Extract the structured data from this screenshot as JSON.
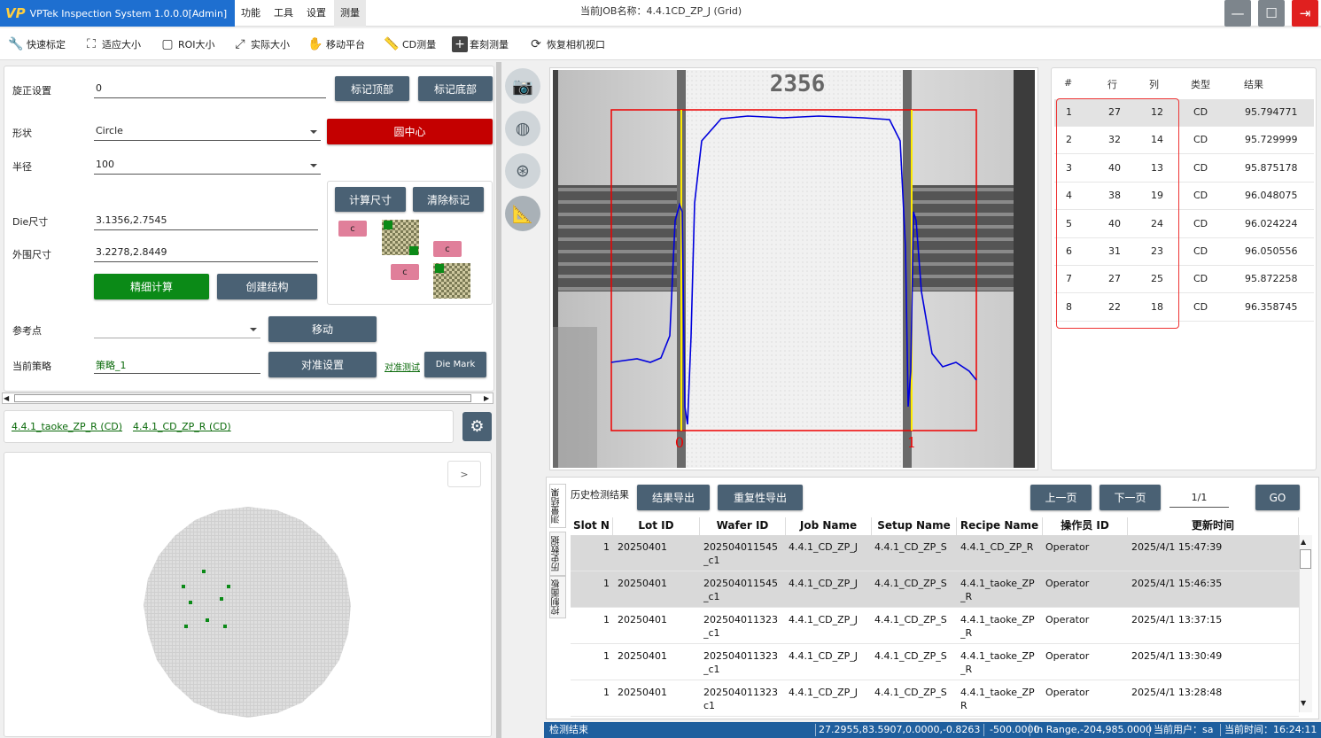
{
  "app": {
    "title": "VPTek Inspection System 1.0.0.0[Admin]",
    "logo": "VP",
    "menus": [
      "功能",
      "工具",
      "设置",
      "测量"
    ],
    "active_menu": 3,
    "job_label": "当前JOB名称：4.4.1CD_ZP_J (Grid)"
  },
  "toolbar": [
    {
      "label": "快速标定",
      "icon": "wrench-icon",
      "glyph": "🔧"
    },
    {
      "label": "适应大小",
      "icon": "fit-size-icon",
      "glyph": "⛶"
    },
    {
      "label": "ROI大小",
      "icon": "roi-icon",
      "glyph": "▢"
    },
    {
      "label": "实际大小",
      "icon": "actual-size-icon",
      "glyph": "⤢"
    },
    {
      "label": "移动平台",
      "icon": "hand-icon",
      "glyph": "✋"
    },
    {
      "label": "CD测量",
      "icon": "ruler-icon",
      "glyph": "📏"
    },
    {
      "label": "套刻测量",
      "icon": "plus-box-icon",
      "glyph": "+"
    },
    {
      "label": "恢复相机视口",
      "icon": "camera-restore-icon",
      "glyph": "⟳"
    }
  ],
  "settings": {
    "rotation_label": "旋正设置",
    "rotation_value": "0",
    "mark_top": "标记顶部",
    "mark_bottom": "标记底部",
    "shape_label": "形状",
    "shape_value": "Circle",
    "circle_center": "圆中心",
    "radius_label": "半径",
    "radius_value": "100",
    "calc_size": "计算尺寸",
    "clear_mark": "清除标记",
    "chip_c": "c",
    "die_size_label": "Die尺寸",
    "die_size_value": "3.1356,2.7545",
    "outer_size_label": "外围尺寸",
    "outer_size_value": "3.2278,2.8449",
    "fine_calc": "精细计算",
    "create_struct": "创建结构",
    "ref_point_label": "参考点",
    "ref_point_value": "",
    "move": "移动",
    "strategy_label": "当前策略",
    "strategy_value": "策略_1",
    "align_setting": "对准设置",
    "align_test": "对准测试",
    "die_mark": "Die Mark"
  },
  "recipes": [
    "4.4.1_taoke_ZP_R (CD)",
    "4.4.1_CD_ZP_R (CD)"
  ],
  "wafer": {
    "expand_label": ">"
  },
  "image": {
    "label_top": "2356",
    "marker_left": "0",
    "marker_right": "1"
  },
  "results": {
    "headers": [
      "#",
      "行",
      "列",
      "类型",
      "结果"
    ],
    "rows": [
      [
        "1",
        "27",
        "12",
        "CD",
        "95.794771"
      ],
      [
        "2",
        "32",
        "14",
        "CD",
        "95.729999"
      ],
      [
        "3",
        "40",
        "13",
        "CD",
        "95.875178"
      ],
      [
        "4",
        "38",
        "19",
        "CD",
        "96.048075"
      ],
      [
        "5",
        "40",
        "24",
        "CD",
        "96.024224"
      ],
      [
        "6",
        "31",
        "23",
        "CD",
        "96.050556"
      ],
      [
        "7",
        "27",
        "25",
        "CD",
        "95.872258"
      ],
      [
        "8",
        "22",
        "18",
        "CD",
        "96.358745"
      ]
    ]
  },
  "history": {
    "tabs": [
      "测量结果",
      "历史数据",
      "控制面板"
    ],
    "title": "历史检测结果",
    "export_result": "结果导出",
    "export_repeat": "重复性导出",
    "prev": "上一页",
    "next": "下一页",
    "page": "1/1",
    "go": "GO",
    "headers": [
      "Slot N",
      "Lot ID",
      "Wafer ID",
      "Job Name",
      "Setup Name",
      "Recipe Name",
      "操作员 ID",
      "更新时间"
    ],
    "rows": [
      {
        "slot": "1",
        "lot": "20250401",
        "wafer": [
          "202504011545",
          "_c1"
        ],
        "job": "4.4.1_CD_ZP_J",
        "setup": "4.4.1_CD_ZP_S",
        "recipe": [
          "4.4.1_CD_ZP_R",
          ""
        ],
        "op": "Operator",
        "time": "2025/4/1 15:47:39"
      },
      {
        "slot": "1",
        "lot": "20250401",
        "wafer": [
          "202504011545",
          "_c1"
        ],
        "job": "4.4.1_CD_ZP_J",
        "setup": "4.4.1_CD_ZP_S",
        "recipe": [
          "4.4.1_taoke_ZP",
          "_R"
        ],
        "op": "Operator",
        "time": "2025/4/1 15:46:35"
      },
      {
        "slot": "1",
        "lot": "20250401",
        "wafer": [
          "202504011323",
          "_c1"
        ],
        "job": "4.4.1_CD_ZP_J",
        "setup": "4.4.1_CD_ZP_S",
        "recipe": [
          "4.4.1_taoke_ZP",
          "_R"
        ],
        "op": "Operator",
        "time": "2025/4/1 13:37:15"
      },
      {
        "slot": "1",
        "lot": "20250401",
        "wafer": [
          "202504011323",
          "_c1"
        ],
        "job": "4.4.1_CD_ZP_J",
        "setup": "4.4.1_CD_ZP_S",
        "recipe": [
          "4.4.1_taoke_ZP",
          "_R"
        ],
        "op": "Operator",
        "time": "2025/4/1 13:30:49"
      },
      {
        "slot": "1",
        "lot": "20250401",
        "wafer": [
          "202504011323",
          "c1"
        ],
        "job": "4.4.1_CD_ZP_J",
        "setup": "4.4.1_CD_ZP_S",
        "recipe": [
          "4.4.1_taoke_ZP",
          "R"
        ],
        "op": "Operator",
        "time": "2025/4/1 13:28:48"
      }
    ]
  },
  "status": {
    "state": "检测结束",
    "coords": "27.2955,83.5907,0.0000,-0.8263",
    "value": "-500.0000",
    "range": "In Range,-204,985.0000",
    "user": "当前用户：sa",
    "time": "当前时间：16:24:11"
  },
  "colors": {
    "brand": "#1e6fd0",
    "accent_red": "#c40000",
    "accent_green": "#0b8a17",
    "status": "#1f5f9e"
  }
}
